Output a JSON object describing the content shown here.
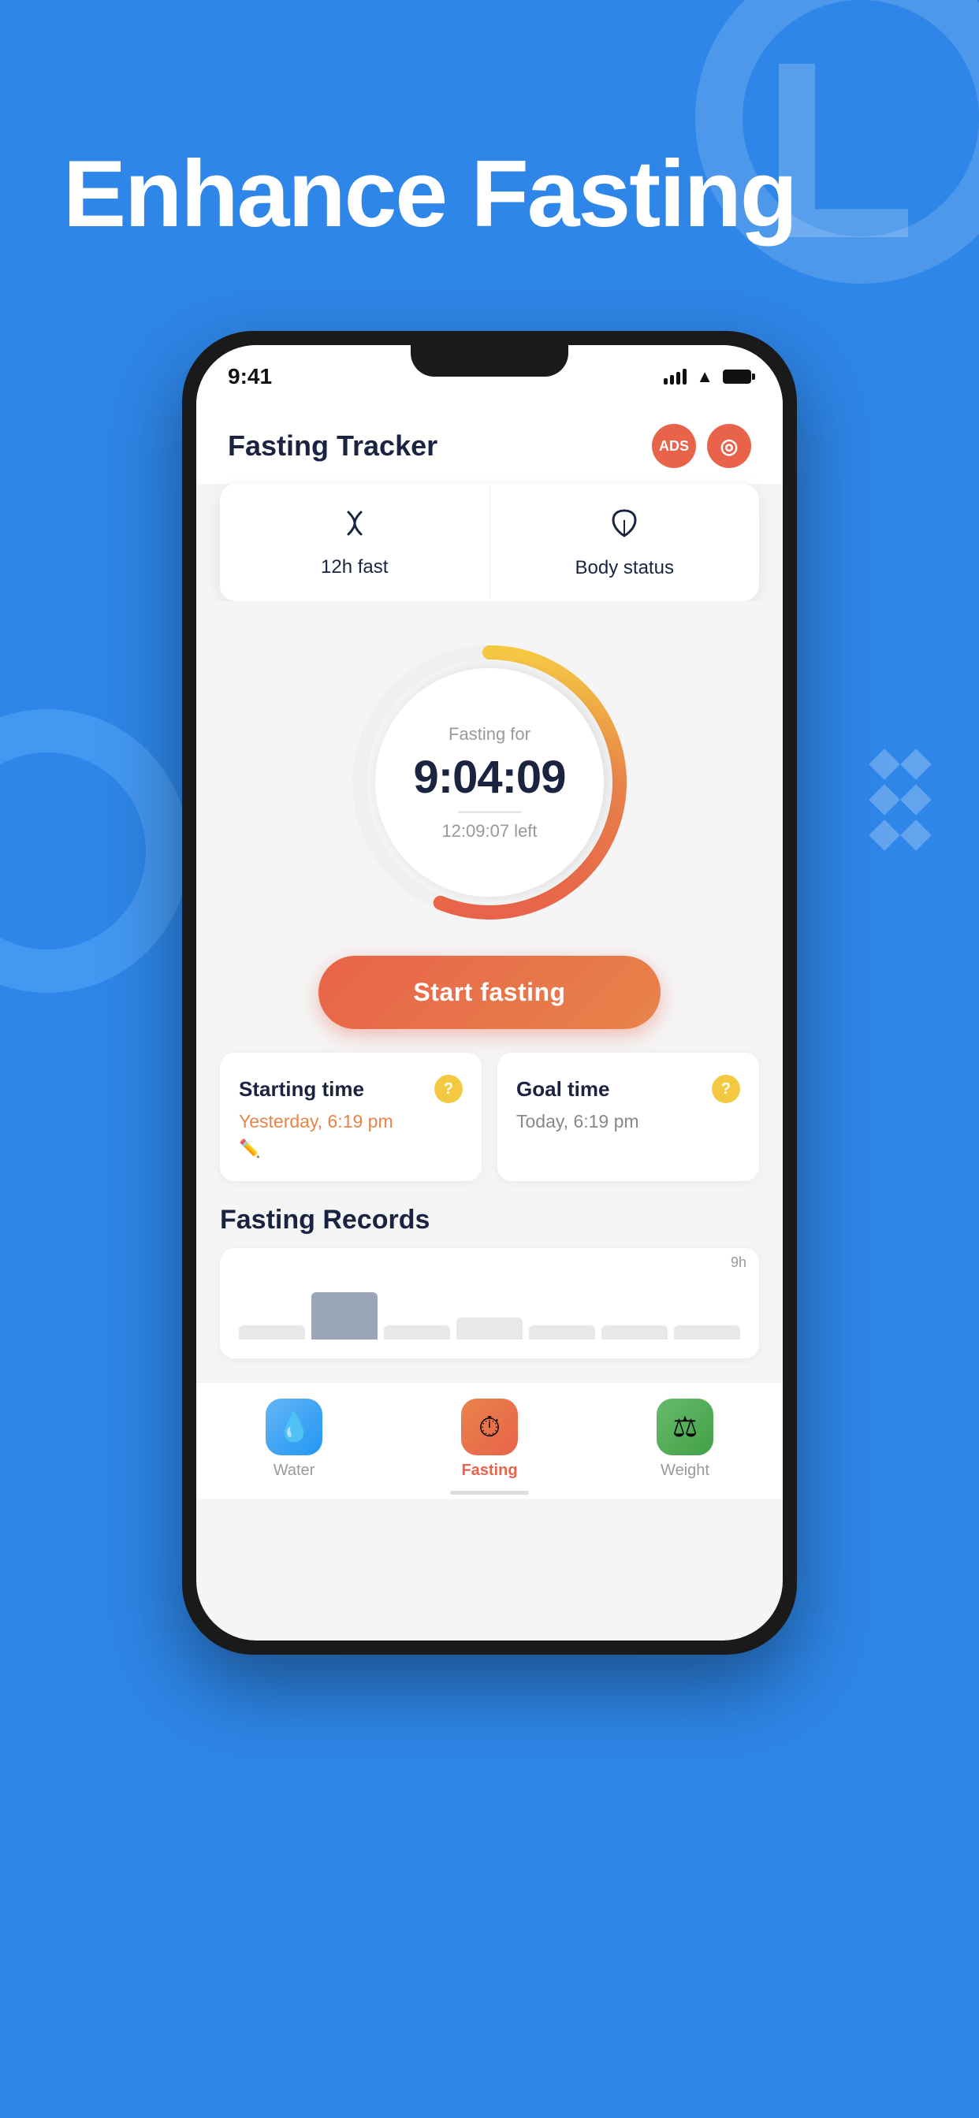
{
  "background": {
    "color": "#2E86E8"
  },
  "heading": {
    "line1": "Enhance Fasting"
  },
  "phone": {
    "status_bar": {
      "time": "9:41",
      "signal_bars": [
        8,
        12,
        16,
        20
      ],
      "wifi": "wifi",
      "battery": "full"
    },
    "header": {
      "title": "Fasting Tracker",
      "icon_ads": "ADS",
      "icon_settings": "⊙"
    },
    "quick_tabs": [
      {
        "icon": "⌒",
        "label": "12h fast"
      },
      {
        "icon": "🍃",
        "label": "Body status"
      }
    ],
    "timer": {
      "label": "Fasting for",
      "time": "9:04:09",
      "time_left": "12:09:07 left"
    },
    "start_button": {
      "label": "Start fasting"
    },
    "time_cards": [
      {
        "title": "Starting time",
        "help": "?",
        "value": "Yesterday, 6:19 pm",
        "edit_icon": "✏"
      },
      {
        "title": "Goal time",
        "help": "?",
        "value": "Today, 6:19 pm"
      }
    ],
    "records": {
      "title": "Fasting Records",
      "chart_max_label": "9h",
      "bars": [
        {
          "height": 20,
          "active": false
        },
        {
          "height": 65,
          "active": true
        },
        {
          "height": 20,
          "active": false
        },
        {
          "height": 30,
          "active": false
        },
        {
          "height": 20,
          "active": false
        },
        {
          "height": 20,
          "active": false
        },
        {
          "height": 20,
          "active": false
        }
      ]
    },
    "bottom_nav": [
      {
        "icon": "💧",
        "label": "Water",
        "active": false
      },
      {
        "icon": "⏱",
        "label": "Fasting",
        "active": true
      },
      {
        "icon": "⚖",
        "label": "Weight",
        "active": false
      }
    ]
  }
}
